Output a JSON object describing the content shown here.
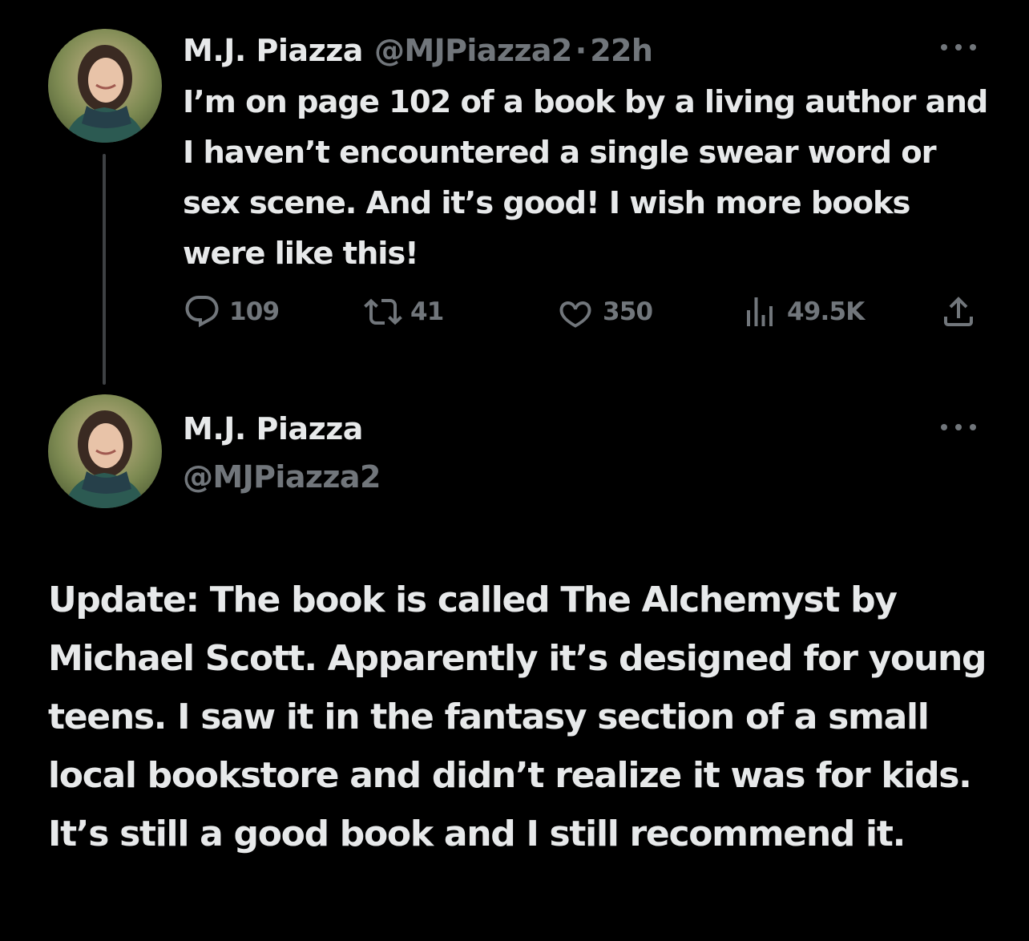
{
  "tweet1": {
    "author_name": "M.J. Piazza",
    "handle": "@MJPiazza2",
    "separator": "·",
    "time": "22h",
    "text": "I’m on page 102 of a book by a living author and I haven’t encountered a single swear word or sex scene. And it’s good! I wish more books were like this!",
    "stats": {
      "replies": "109",
      "retweets": "41",
      "likes": "350",
      "views": "49.5K"
    }
  },
  "tweet2": {
    "author_name": "M.J. Piazza",
    "handle": "@MJPiazza2",
    "text": "Update: The book is called The Alchemyst by Michael Scott. Apparently it’s designed for young teens. I saw it in the fantasy section of a small local bookstore and didn’t realize it was for kids. It’s still a good book and I still recommend it."
  },
  "icons": {
    "reply": "reply-icon",
    "retweet": "retweet-icon",
    "like": "heart-icon",
    "views": "views-icon",
    "share": "share-icon",
    "more": "more-icon"
  },
  "colors": {
    "background": "#000000",
    "primary_text": "#e7e9ea",
    "secondary_text": "#71767b",
    "thread_line": "#3e4144"
  }
}
